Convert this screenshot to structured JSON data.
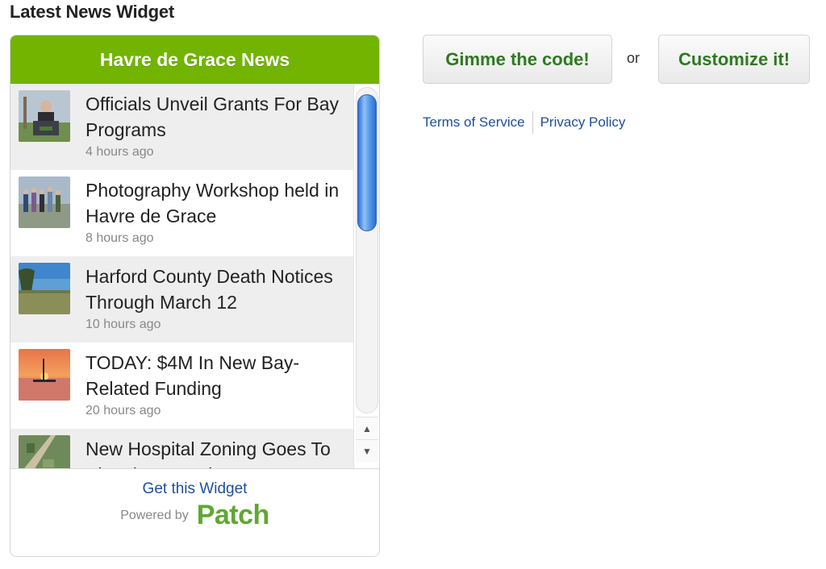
{
  "page": {
    "title": "Latest News Widget"
  },
  "widget": {
    "header": "Havre de Grace News",
    "items": [
      {
        "title": "Officials Unveil Grants For Bay Programs",
        "time": "4 hours ago",
        "thumb": "thumb-person-podium"
      },
      {
        "title": "Photography Workshop held in Havre de Grace",
        "time": "8 hours ago",
        "thumb": "thumb-group-outdoors"
      },
      {
        "title": "Harford County Death Notices Through March 12",
        "time": "10 hours ago",
        "thumb": "thumb-field-sky"
      },
      {
        "title": "TODAY: $4M In New Bay-Related Funding",
        "time": "20 hours ago",
        "thumb": "thumb-sunset-boat"
      },
      {
        "title": "New Hospital Zoning Goes To Planning Board",
        "time": "",
        "thumb": "thumb-aerial-map"
      }
    ],
    "footer": {
      "get_widget": "Get this Widget",
      "powered_by": "Powered by",
      "logo": "Patch"
    }
  },
  "actions": {
    "code_button": "Gimme the code!",
    "or_text": "or",
    "customize_button": "Customize it!"
  },
  "links": {
    "terms": "Terms of Service",
    "privacy": "Privacy Policy"
  },
  "colors": {
    "header_green": "#72b400",
    "button_text_green": "#2d7a1f",
    "link_blue": "#1f4f9a",
    "patch_green": "#5fa830"
  }
}
